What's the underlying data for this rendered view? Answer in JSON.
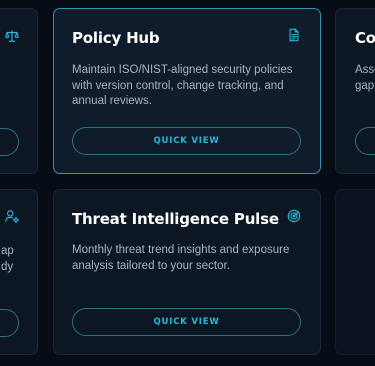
{
  "colors": {
    "accent": "#2ab7d8",
    "background": "#070d16",
    "card": "#0d1724",
    "active_border": "#2f93b2"
  },
  "cards": [
    {
      "title": "Policy Hub",
      "description": "Maintain ISO/NIST-aligned security policies with version control, change tracking, and annual reviews.",
      "button": "QUICK VIEW",
      "icon": "document-icon"
    },
    {
      "title": "Threat Intelligence Pulse",
      "description": "Monthly threat trend insights and exposure analysis tailored to your sector.",
      "button": "QUICK VIEW",
      "icon": "radar-icon"
    }
  ],
  "partial_cards": {
    "top_right_title": "Co",
    "top_right_desc_line1": "Asse",
    "top_right_desc_line2": "gap",
    "bottom_left_desc_line1": "ap",
    "bottom_left_desc_line2": "dy"
  }
}
